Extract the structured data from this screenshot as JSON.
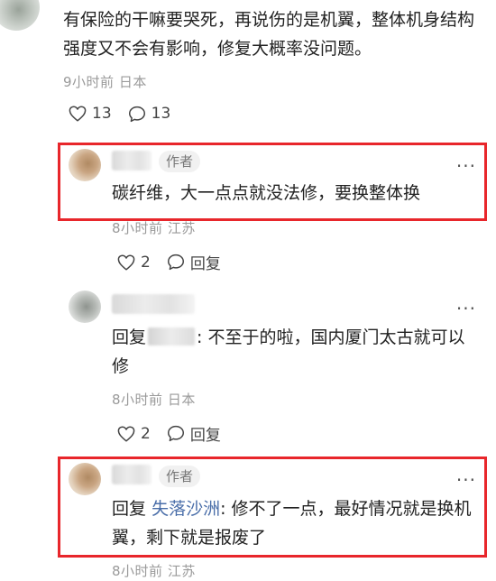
{
  "top_comment": {
    "text": "有保险的干嘛要哭死，再说伤的是机翼，整体机身结构强度又不会有影响，修复大概率没问题。",
    "time": "9小时前",
    "location": "日本",
    "likes": "13",
    "comments": "13"
  },
  "replies": [
    {
      "author_tag": "作者",
      "text": "碳纤维，大一点点就没法修，要换整体换",
      "time": "8小时前",
      "location": "江苏",
      "likes": "2",
      "reply_label": "回复"
    },
    {
      "reply_prefix": "回复",
      "text": ": 不至于的啦，国内厦门太古就可以修",
      "time": "8小时前",
      "location": "日本",
      "likes": "2",
      "reply_label": "回复"
    },
    {
      "author_tag": "作者",
      "reply_prefix": "回复",
      "mention": "失落沙洲",
      "text": ": 修不了一点，最好情况就是换机翼，剩下就是报废了",
      "time": "8小时前",
      "location": "江苏"
    }
  ],
  "colors": {
    "highlight_border": "#e8262b",
    "mention": "#4a6ea9",
    "meta": "#9a9a9a"
  }
}
